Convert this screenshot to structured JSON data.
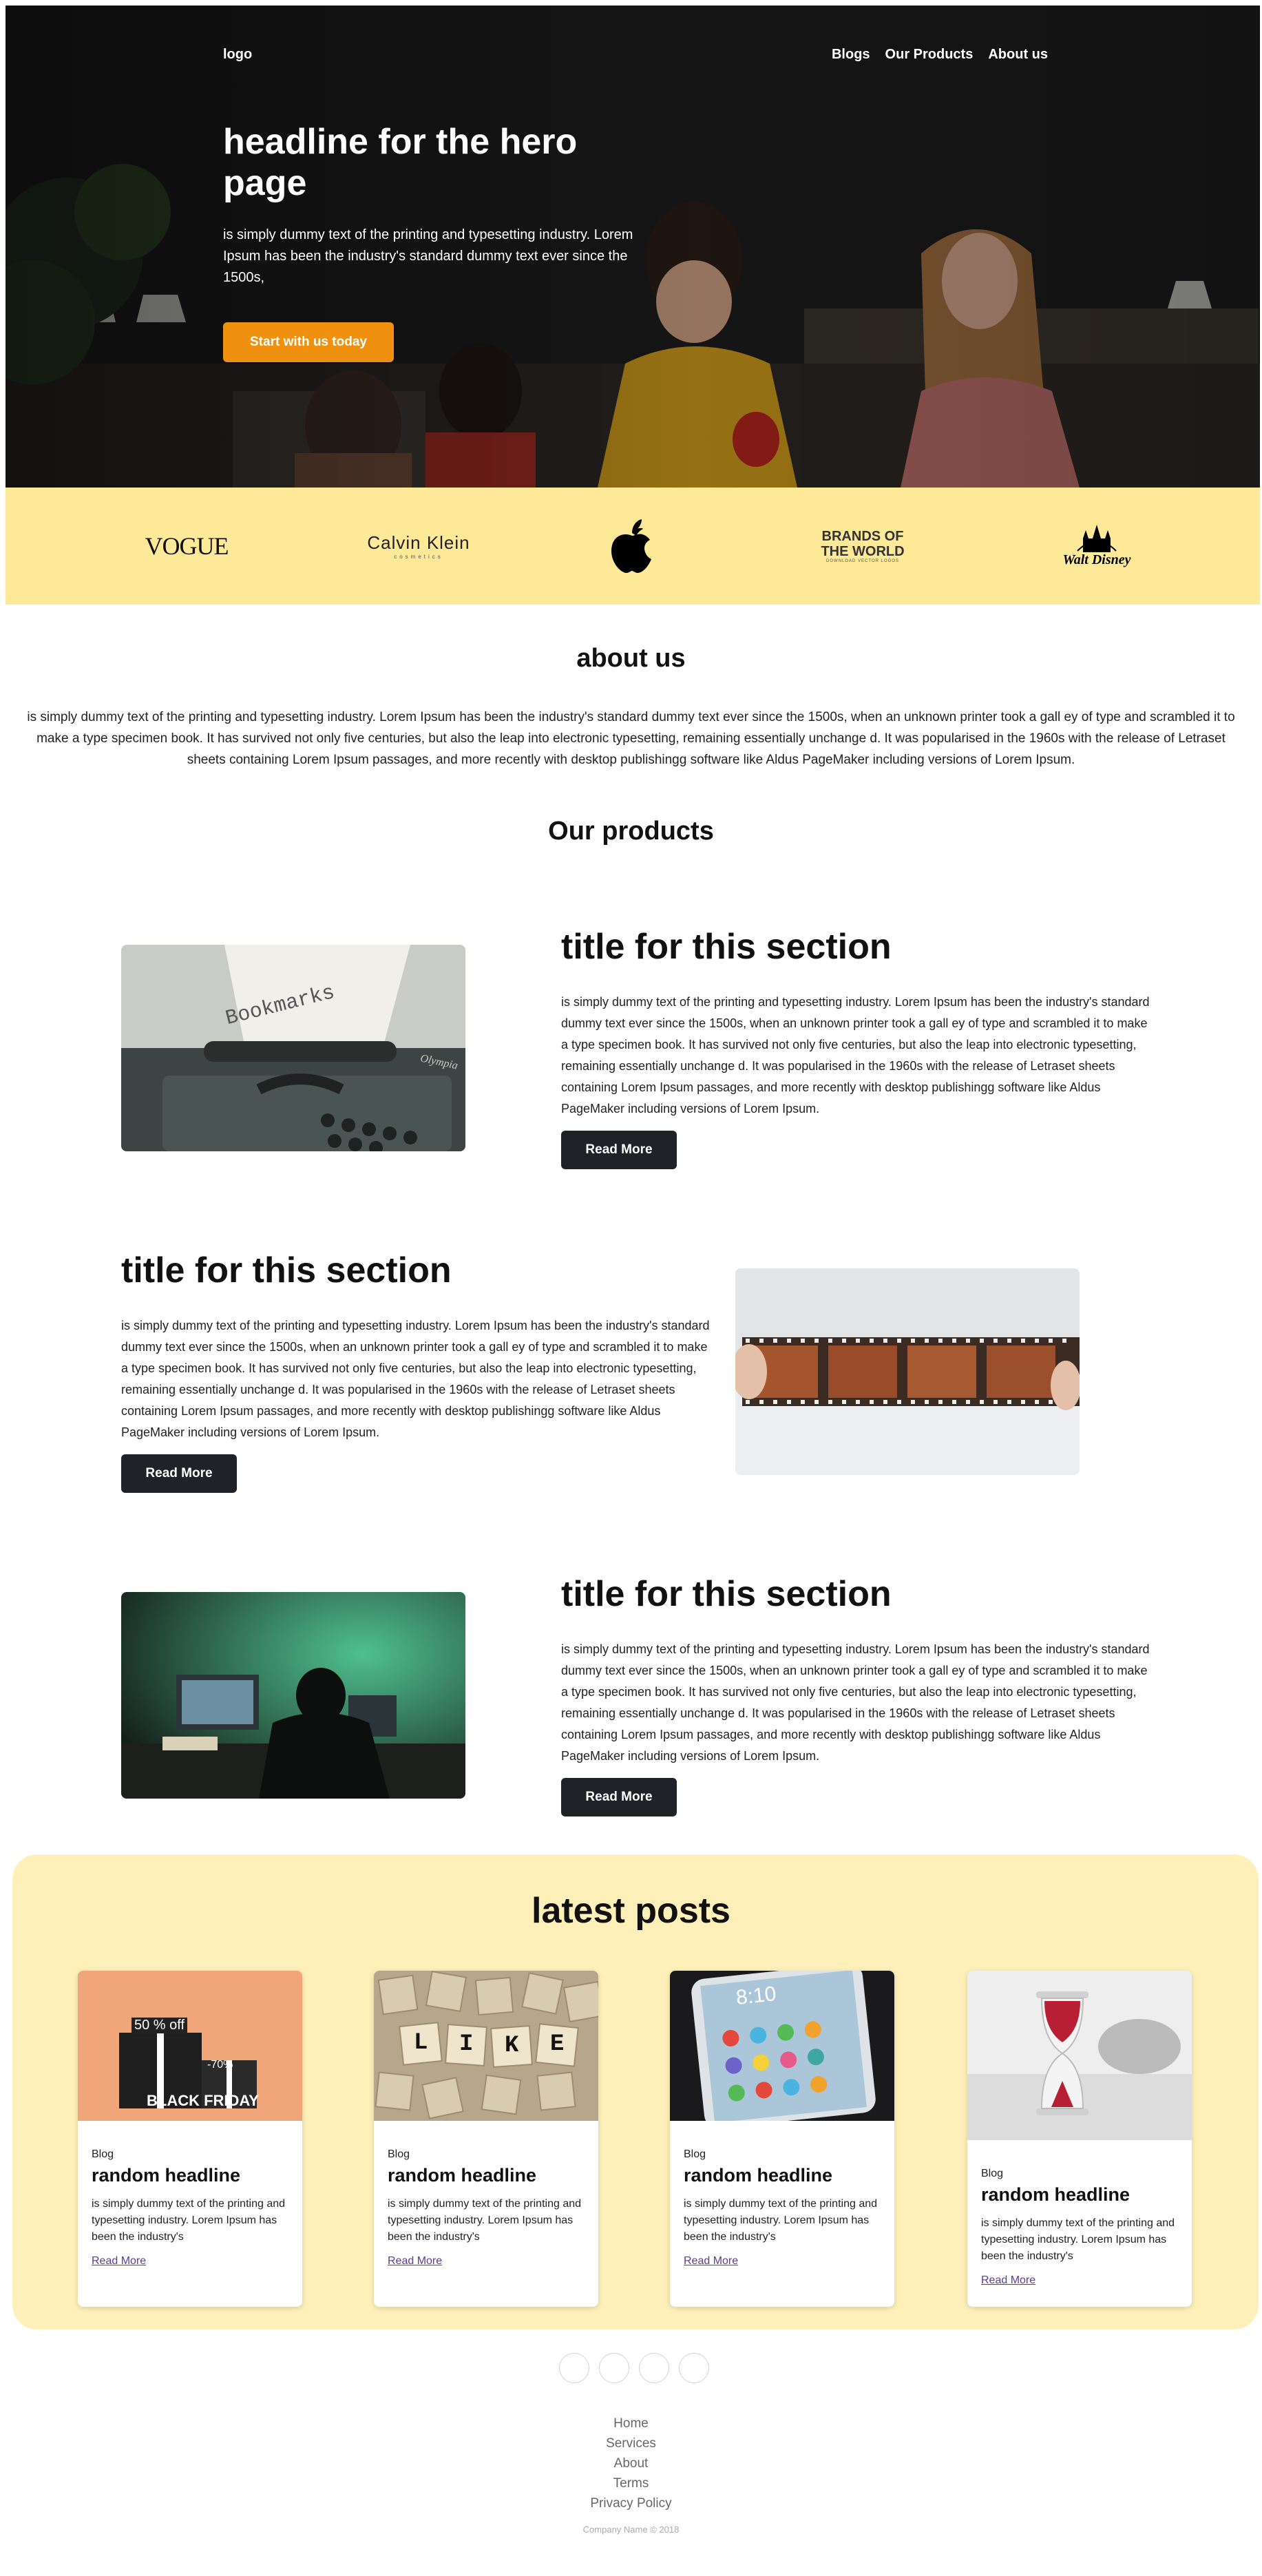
{
  "nav": {
    "logo": "logo",
    "links": [
      "Blogs",
      "Our Products",
      "About us"
    ]
  },
  "hero": {
    "title": "headline for the hero page",
    "text": "is simply dummy text of the printing and typesetting industry. Lorem Ipsum has been the industry's standard dummy text ever since the 1500s,",
    "button": "Start with us today"
  },
  "brands": {
    "items": [
      "VOGUE",
      "Calvin Klein",
      "apple-logo",
      "BRANDS OF THE WORLD",
      "Walt Disney"
    ],
    "ck_sub": "cosmetics",
    "botw_sub": "DOWNLOAD VECTOR LOGOS"
  },
  "about": {
    "title": "about us",
    "text": "is simply dummy text of the printing and typesetting industry. Lorem Ipsum has been the industry's standard dummy text ever since the 1500s, when an unknown printer took a gall ey of type and scrambled it to make a type specimen book. It has survived not only five centuries, but also the leap into electronic typesetting, remaining essentially unchange d. It was popularised in the 1960s with the release of Letraset sheets containing Lorem Ipsum passages, and more recently with desktop publishingg software like Aldus PageMaker including versions of Lorem Ipsum."
  },
  "products": {
    "title": "Our products",
    "items": [
      {
        "title": "title for this section",
        "text": "is simply dummy text of the printing and typesetting industry. Lorem Ipsum has been the industry's standard dummy text ever since the 1500s, when an unknown printer took a gall ey of type and scrambled it to make a type specimen book. It has survived not only five centuries, but also the leap into electronic typesetting, remaining essentially unchange d. It was popularised in the 1960s with the release of Letraset sheets containing Lorem Ipsum passages, and more recently with desktop publishingg software like Aldus PageMaker including versions of Lorem Ipsum.",
        "button": "Read More",
        "image_text": "Bookmarks",
        "image_brand": "Olympia"
      },
      {
        "title": "title for this section",
        "text": "is simply dummy text of the printing and typesetting industry. Lorem Ipsum has been the industry's standard dummy text ever since the 1500s, when an unknown printer took a gall ey of type and scrambled it to make a type specimen book. It has survived not only five centuries, but also the leap into electronic typesetting, remaining essentially unchange d. It was popularised in the 1960s with the release of Letraset sheets containing Lorem Ipsum passages, and more recently with desktop publishingg software like Aldus PageMaker including versions of Lorem Ipsum.",
        "button": "Read More"
      },
      {
        "title": "title for this section",
        "text": "is simply dummy text of the printing and typesetting industry. Lorem Ipsum has been the industry's standard dummy text ever since the 1500s, when an unknown printer took a gall ey of type and scrambled it to make a type specimen book. It has survived not only five centuries, but also the leap into electronic typesetting, remaining essentially unchange d. It was popularised in the 1960s with the release of Letraset sheets containing Lorem Ipsum passages, and more recently with desktop publishingg software like Aldus PageMaker including versions of Lorem Ipsum.",
        "button": "Read More"
      }
    ]
  },
  "posts": {
    "title": "latest posts",
    "items": [
      {
        "category": "Blog",
        "title": "random headline",
        "text": "is simply dummy text of the printing and typesetting industry. Lorem Ipsum has been the industry's",
        "link": "Read More",
        "img_text_1": "50 % off",
        "img_text_2": "-70%",
        "img_text_3": "BLACK FRIDAY"
      },
      {
        "category": "Blog",
        "title": "random headline",
        "text": "is simply dummy text of the printing and typesetting industry. Lorem Ipsum has been the industry's",
        "link": "Read More",
        "tiles": [
          "L",
          "I",
          "K",
          "E"
        ]
      },
      {
        "category": "Blog",
        "title": "random headline",
        "text": "is simply dummy text of the printing and typesetting industry. Lorem Ipsum has been the industry's",
        "link": "Read More",
        "clock": "8:10"
      },
      {
        "category": "Blog",
        "title": "random headline",
        "text": "is simply dummy text of the printing and typesetting industry. Lorem Ipsum has been the industry's",
        "link": "Read More"
      }
    ]
  },
  "footer": {
    "links": [
      "Home",
      "Services",
      "About",
      "Terms",
      "Privacy Policy"
    ],
    "copyright": "Company Name © 2018"
  },
  "colors": {
    "accent_orange": "#f0900f",
    "brand_band": "#fde998",
    "posts_bg": "#fef0b8",
    "dark_button": "#1f2328",
    "link_purple": "#5b3a9a"
  }
}
